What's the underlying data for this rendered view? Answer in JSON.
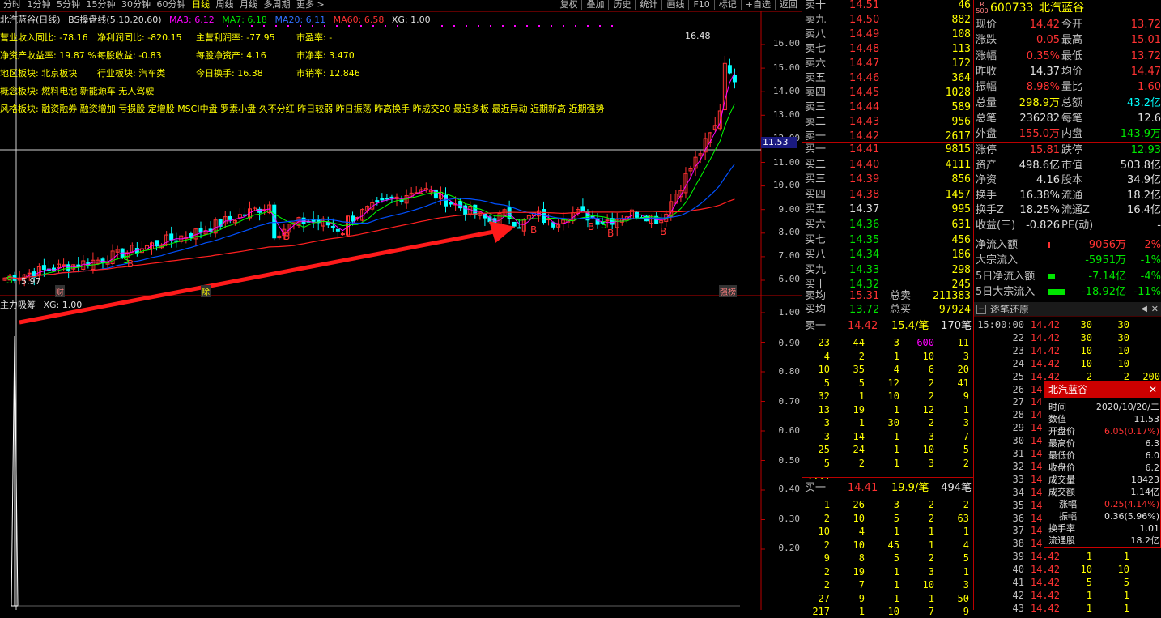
{
  "toolbar": {
    "periods": [
      "分时",
      "1分钟",
      "5分钟",
      "15分钟",
      "30分钟",
      "60分钟",
      "日线",
      "周线",
      "月线",
      "多周期",
      "更多 >"
    ],
    "active_period": "日线",
    "right_buttons": [
      "复权",
      "叠加",
      "历史",
      "统计",
      "画线",
      "F10",
      "标记",
      "+自选",
      "返回"
    ]
  },
  "indicator_line": {
    "name": "北汽蓝谷(日线)",
    "formula": "BS操盘线(5,10,20,60)",
    "ma3": "MA3: 6.12",
    "ma7": "MA7: 6.18",
    "ma20": "MA20: 6.11",
    "ma60": "MA60: 6.58",
    "xg": "XG: 1.00"
  },
  "fundamentals": {
    "r1": [
      "营业收入同比: -78.16",
      "净利润同比: -820.15",
      "主营利润率: -77.95",
      "市盈率: -"
    ],
    "r2": [
      "净资产收益率: 19.87 %",
      "每股收益: -0.83",
      "每股净资产: 4.16",
      "市净率: 3.470"
    ],
    "r3": [
      "地区板块: 北京板块",
      "行业板块: 汽车类",
      "今日换手: 16.38",
      "市销率: 12.846"
    ],
    "r4": [
      "概念板块: 燃料电池 新能源车 无人驾驶"
    ],
    "r5": [
      "风格板块: 融资融券 融资增加 亏损股 定增股 MSCI中盘 罗素小盘 久不分红 昨日较弱 昨日振荡 昨高换手 昨成交20 最近多板 最近异动 近期新高 近期强势"
    ]
  },
  "main_chart": {
    "y_ticks": [
      "16.00",
      "15.00",
      "14.00",
      "13.00",
      "12.00",
      "11.00",
      "10.00",
      "9.00",
      "8.00",
      "7.00",
      "6.00"
    ],
    "high_label": "16.48",
    "low_label": "5.97",
    "cursor_price": "11.53",
    "bottom_markers": [
      "财",
      "除",
      "强榜"
    ]
  },
  "sub_chart": {
    "title": "主力吸筹",
    "xg": "XG: 1.00",
    "y_ticks": [
      "1.00",
      "0.90",
      "0.80",
      "0.70",
      "0.60",
      "0.50",
      "0.40",
      "0.30",
      "0.20"
    ]
  },
  "order_book": {
    "sells": [
      {
        "label": "卖十",
        "price": "14.51",
        "vol": "46"
      },
      {
        "label": "卖九",
        "price": "14.50",
        "vol": "882"
      },
      {
        "label": "卖八",
        "price": "14.49",
        "vol": "108"
      },
      {
        "label": "卖七",
        "price": "14.48",
        "vol": "113"
      },
      {
        "label": "卖六",
        "price": "14.47",
        "vol": "172"
      },
      {
        "label": "卖五",
        "price": "14.46",
        "vol": "364"
      },
      {
        "label": "卖四",
        "price": "14.45",
        "vol": "1028"
      },
      {
        "label": "卖三",
        "price": "14.44",
        "vol": "589"
      },
      {
        "label": "卖二",
        "price": "14.43",
        "vol": "956"
      },
      {
        "label": "卖一",
        "price": "14.42",
        "vol": "2617"
      }
    ],
    "buys": [
      {
        "label": "买一",
        "price": "14.41",
        "vol": "9815"
      },
      {
        "label": "买二",
        "price": "14.40",
        "vol": "4111"
      },
      {
        "label": "买三",
        "price": "14.39",
        "vol": "856"
      },
      {
        "label": "买四",
        "price": "14.38",
        "vol": "1457"
      },
      {
        "label": "买五",
        "price": "14.37",
        "vol": "995"
      },
      {
        "label": "买六",
        "price": "14.36",
        "vol": "631"
      },
      {
        "label": "买七",
        "price": "14.35",
        "vol": "456"
      },
      {
        "label": "买八",
        "price": "14.34",
        "vol": "186"
      },
      {
        "label": "买九",
        "price": "14.33",
        "vol": "298"
      },
      {
        "label": "买十",
        "price": "14.32",
        "vol": "245"
      }
    ],
    "avg_sell": {
      "label": "卖均",
      "price": "15.31",
      "tlabel": "总卖",
      "vol": "211383"
    },
    "avg_buy": {
      "label": "买均",
      "price": "13.72",
      "tlabel": "总买",
      "vol": "97924"
    }
  },
  "quote": {
    "badge": "R 500",
    "code": "600733",
    "name": "北汽蓝谷",
    "rows": [
      [
        "现价",
        "14.42",
        "今开",
        "13.72"
      ],
      [
        "涨跌",
        "0.05",
        "最高",
        "15.01"
      ],
      [
        "涨幅",
        "0.35%",
        "最低",
        "13.72"
      ],
      [
        "昨收",
        "14.37",
        "均价",
        "14.47"
      ],
      [
        "振幅",
        "8.98%",
        "量比",
        "1.60"
      ],
      [
        "总量",
        "298.9万",
        "总额",
        "43.2亿"
      ],
      [
        "总笔",
        "236282",
        "每笔",
        "12.6"
      ],
      [
        "外盘",
        "155.0万",
        "内盘",
        "143.9万"
      ],
      [
        "涨停",
        "15.81",
        "跌停",
        "12.93"
      ],
      [
        "资产",
        "498.6亿",
        "市值",
        "503.8亿"
      ],
      [
        "净资",
        "4.16",
        "股本",
        "34.9亿"
      ],
      [
        "换手",
        "16.38%",
        "流通",
        "18.2亿"
      ],
      [
        "换手Z",
        "18.25%",
        "流通Z",
        "16.4亿"
      ],
      [
        "收益(三)",
        "-0.826",
        "PE(动)",
        "-"
      ]
    ],
    "flows": [
      [
        "净流入额",
        "9056万",
        "2%"
      ],
      [
        "大宗流入",
        "-5951万",
        "-1%"
      ],
      [
        "5日净流入额",
        "-7.14亿",
        "-4%"
      ],
      [
        "5日大宗流入",
        "-18.92亿",
        "-11%"
      ]
    ]
  },
  "queue": {
    "sell_head": {
      "label": "卖一",
      "price": "14.42",
      "avg": "15.4/笔",
      "count": "170笔"
    },
    "sell_rows": [
      [
        "23",
        "44",
        "3",
        "600",
        "11"
      ],
      [
        "4",
        "2",
        "1",
        "10",
        "3"
      ],
      [
        "10",
        "35",
        "4",
        "6",
        "20"
      ],
      [
        "5",
        "5",
        "12",
        "2",
        "41"
      ],
      [
        "32",
        "1",
        "10",
        "2",
        "9"
      ],
      [
        "13",
        "19",
        "1",
        "12",
        "1"
      ],
      [
        "3",
        "1",
        "30",
        "2",
        "3"
      ],
      [
        "3",
        "14",
        "1",
        "3",
        "7"
      ],
      [
        "25",
        "24",
        "1",
        "10",
        "5"
      ],
      [
        "5",
        "2",
        "1",
        "3",
        "2"
      ],
      [
        "....",
        "",
        "",
        "",
        ""
      ]
    ],
    "buy_head": {
      "label": "买一",
      "price": "14.41",
      "avg": "19.9/笔",
      "count": "494笔"
    },
    "buy_rows": [
      [
        "1",
        "26",
        "3",
        "2",
        "2"
      ],
      [
        "2",
        "10",
        "5",
        "2",
        "63"
      ],
      [
        "10",
        "4",
        "1",
        "1",
        "1"
      ],
      [
        "2",
        "10",
        "45",
        "1",
        "4"
      ],
      [
        "9",
        "8",
        "5",
        "2",
        "5"
      ],
      [
        "2",
        "19",
        "1",
        "3",
        "1"
      ],
      [
        "2",
        "7",
        "1",
        "10",
        "3"
      ],
      [
        "27",
        "9",
        "1",
        "1",
        "50"
      ],
      [
        "217",
        "1",
        "10",
        "7",
        "9"
      ]
    ]
  },
  "ticks": {
    "title": "逐笔还原",
    "rows": [
      [
        "15:00:00",
        "14.42",
        "30",
        "30",
        ""
      ],
      [
        "22",
        "14.42",
        "30",
        "30",
        ""
      ],
      [
        "23",
        "14.42",
        "10",
        "10",
        ""
      ],
      [
        "24",
        "14.42",
        "10",
        "10",
        ""
      ],
      [
        "25",
        "14.42",
        "2",
        "2",
        "200"
      ],
      [
        "26",
        "14.42",
        "",
        "",
        ""
      ],
      [
        "27",
        "14.42",
        "",
        "",
        ""
      ],
      [
        "28",
        "14.42",
        "",
        "",
        ""
      ],
      [
        "29",
        "14.42",
        "",
        "",
        ""
      ],
      [
        "30",
        "14.42",
        "",
        "",
        ""
      ],
      [
        "31",
        "14.42",
        "",
        "",
        ""
      ],
      [
        "32",
        "14.42",
        "",
        "",
        ""
      ],
      [
        "33",
        "14.42",
        "",
        "",
        ""
      ],
      [
        "34",
        "14.42",
        "",
        "",
        ""
      ],
      [
        "35",
        "14.42",
        "",
        "",
        ""
      ],
      [
        "36",
        "14.42",
        "",
        "",
        ""
      ],
      [
        "37",
        "14.42",
        "",
        "",
        ""
      ],
      [
        "38",
        "14.42",
        "",
        "",
        ""
      ],
      [
        "39",
        "14.42",
        "1",
        "1",
        ""
      ],
      [
        "40",
        "14.42",
        "10",
        "10",
        ""
      ],
      [
        "41",
        "14.42",
        "5",
        "5",
        ""
      ],
      [
        "42",
        "14.42",
        "1",
        "1",
        ""
      ],
      [
        "43",
        "14.42",
        "1",
        "1",
        ""
      ]
    ]
  },
  "popup": {
    "title": "北汽蓝谷",
    "rows": [
      [
        "时间",
        "2020/10/20/二"
      ],
      [
        "数值",
        "11.53"
      ],
      [
        "开盘价",
        "6.05(0.17%)"
      ],
      [
        "最高价",
        "6.3"
      ],
      [
        "最低价",
        "6.0"
      ],
      [
        "收盘价",
        "6.2"
      ],
      [
        "成交量",
        "18423"
      ],
      [
        "成交额",
        "1.14亿"
      ],
      [
        "涨幅",
        "0.25(4.14%)"
      ],
      [
        "振幅",
        "0.36(5.96%)"
      ],
      [
        "换手率",
        "1.01"
      ],
      [
        "流通股",
        "18.2亿"
      ]
    ]
  },
  "colors": {
    "up": "#ff3232",
    "down": "#00ffff",
    "ma3": "#ff00ff",
    "ma7": "#00ff00",
    "ma20": "#0050ff",
    "ma60": "#ff2020",
    "text_yellow": "#ffff00"
  }
}
